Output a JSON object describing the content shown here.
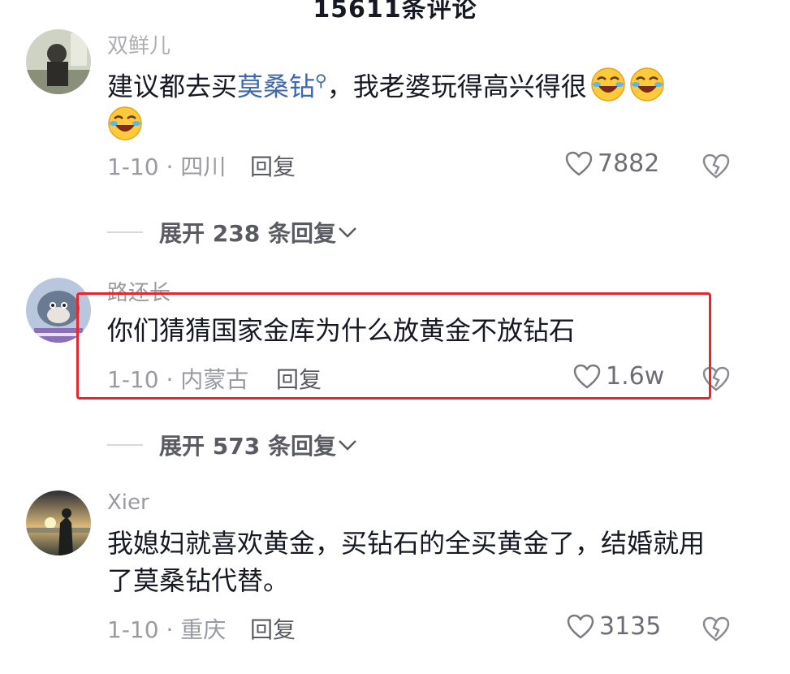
{
  "header": {
    "comment_count": "15611条评论"
  },
  "comments": [
    {
      "username": "双鲜儿",
      "text_before": "建议都去买",
      "link": "莫桑钻",
      "text_after": "，我老婆玩得高兴得很",
      "emojis": [
        "laughing-crying-emoji",
        "laughing-crying-emoji",
        "laughing-crying-emoji"
      ],
      "date_location": "1-10 · 四川",
      "reply_label": "回复",
      "likes": "7882",
      "expand": "展开 238 条回复"
    },
    {
      "username": "路还长",
      "text": "你们猜猜国家金库为什么放黄金不放钻石",
      "date_location": "1-10 · 内蒙古",
      "reply_label": "回复",
      "likes": "1.6w",
      "expand": "展开 573 条回复"
    },
    {
      "username": "Xier",
      "text": "我媳妇就喜欢黄金，买钻石的全买黄金了，结婚就用了莫桑钻代替。",
      "date_location": "1-10 · 重庆",
      "reply_label": "回复",
      "likes": "3135"
    }
  ],
  "colors": {
    "link": "#3d67b1",
    "highlight": "#e6262e",
    "muted": "#9a9ba0"
  }
}
